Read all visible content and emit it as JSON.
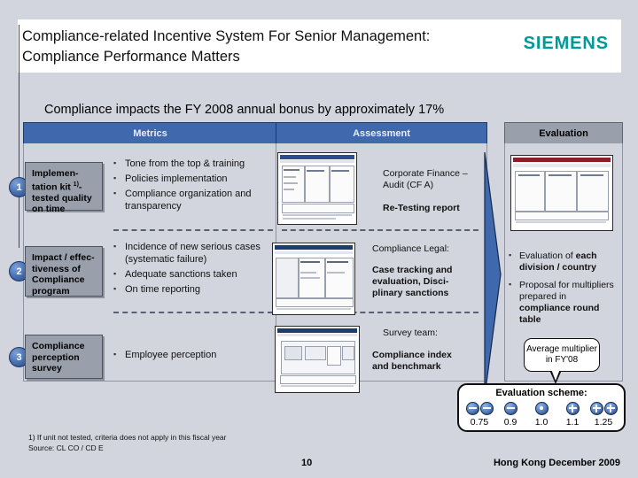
{
  "header": {
    "title": "Compliance-related Incentive System For Senior Management: Compliance Performance Matters",
    "logo": "SIEMENS",
    "logo_color": "#009999"
  },
  "subtitle": "Compliance impacts the FY 2008 annual bonus by approximately 17%",
  "columns": {
    "metrics": "Metrics",
    "assessment": "Assessment",
    "evaluation": "Evaluation"
  },
  "rows": [
    {
      "number": "1",
      "metric_label": "Implementation kit 1)- tested quality on time",
      "bullets": [
        "Tone from the top & training",
        "Policies implementation",
        "Compliance organization and transparency"
      ],
      "assessment_owner": "Corporate Finance – Audit (CF A)",
      "assessment_output": "Re-Testing report"
    },
    {
      "number": "2",
      "metric_label": "Impact / effec-tiveness of Compliance program",
      "bullets": [
        "Incidence of new serious cases (systematic failure)",
        "Adequate sanctions taken",
        "On time reporting"
      ],
      "assessment_owner": "Compliance Legal:",
      "assessment_output": "Case tracking and evaluation, Disci-plinary sanctions"
    },
    {
      "number": "3",
      "metric_label": "Compliance perception survey",
      "bullets": [
        "Employee perception"
      ],
      "assessment_owner": "Survey team:",
      "assessment_output": "Compliance index and benchmark"
    }
  ],
  "evaluation": {
    "bullets": [
      {
        "pre": "Evaluation of ",
        "bold": "each division / country",
        "post": ""
      },
      {
        "pre": "Proposal for multipliers prepared in ",
        "bold": "compliance round table",
        "post": ""
      }
    ],
    "callout": "Average multiplier in FY'08"
  },
  "scheme": {
    "title": "Evaluation scheme:",
    "items": [
      {
        "icon": "minus-minus-icon",
        "value": "0.75"
      },
      {
        "icon": "minus-icon",
        "value": "0.9"
      },
      {
        "icon": "neutral-dot-icon",
        "value": "1.0"
      },
      {
        "icon": "plus-icon",
        "value": "1.1"
      },
      {
        "icon": "plus-plus-icon",
        "value": "1.25"
      }
    ]
  },
  "footer": {
    "footnote": "1) If unit not tested, criteria does not apply in this fiscal year",
    "source": "Source: CL CO / CD E",
    "page": "10",
    "venue": "Hong Kong December 2009"
  },
  "thumbnails": {
    "t1_name": "re-testing-report-thumbnail",
    "t2_name": "case-tracking-report-thumbnail",
    "t3_name": "survey-report-thumbnail",
    "t4_name": "evaluation-report-thumbnail"
  }
}
